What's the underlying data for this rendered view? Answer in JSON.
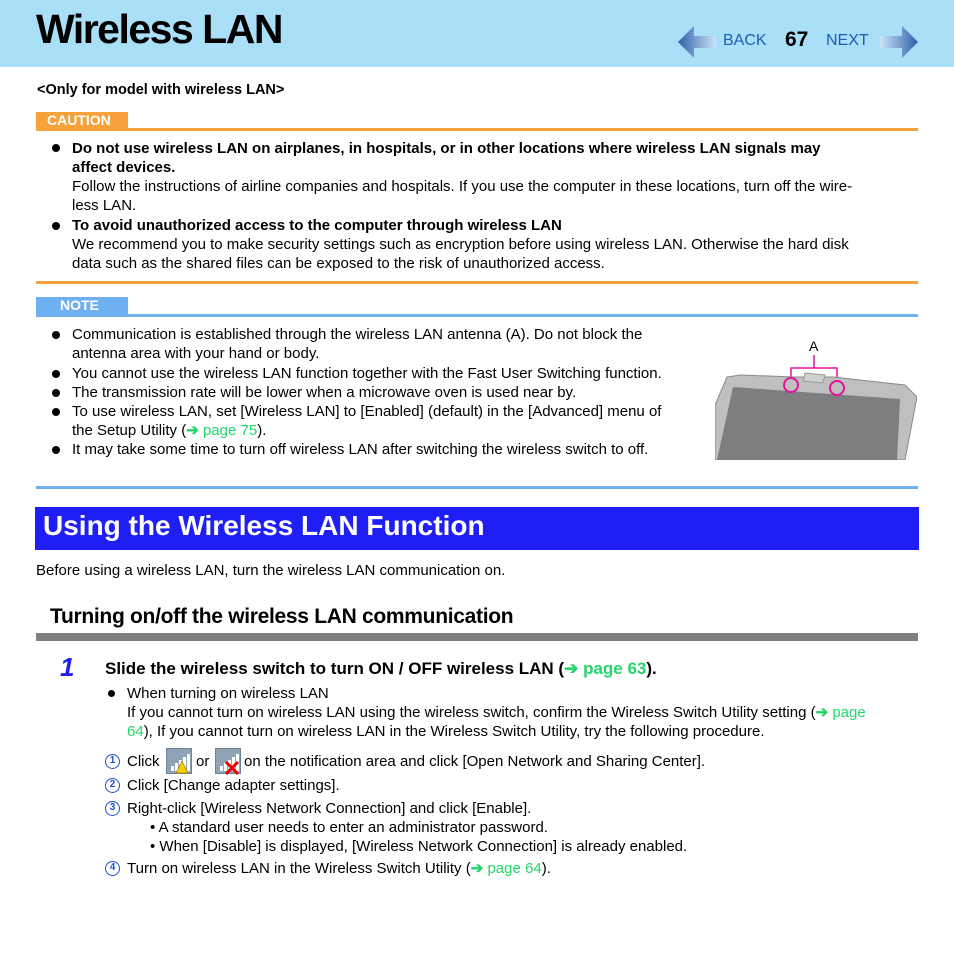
{
  "header": {
    "title": "Wireless LAN",
    "back_label": "BACK",
    "page_number": "67",
    "next_label": "NEXT",
    "background_color": "#a9dff7"
  },
  "model_note": "<Only for model with wireless LAN>",
  "caution": {
    "tag": "CAUTION",
    "color": "#f7a13b",
    "items": [
      {
        "heading_lines": [
          "Do not use wireless LAN on airplanes, in hospitals, or in other locations where wireless LAN signals may",
          "affect devices."
        ],
        "body_lines": [
          "Follow the instructions of airline companies and hospitals. If you use the computer in these locations, turn off the wire-",
          "less LAN."
        ]
      },
      {
        "heading_lines": [
          "To avoid unauthorized access to the computer through wireless LAN"
        ],
        "body_lines": [
          "We recommend you to make security settings such as encryption before using wireless LAN. Otherwise the hard disk",
          "data such as the shared files can be exposed to the risk of unauthorized access."
        ]
      }
    ]
  },
  "note": {
    "tag": "NOTE",
    "color": "#6fb0f1",
    "items": [
      {
        "lines": [
          "Communication is established through the wireless LAN antenna (A). Do not block the",
          "antenna area with your hand or body."
        ]
      },
      {
        "lines": [
          "You cannot use the wireless LAN function together with the Fast User Switching function."
        ]
      },
      {
        "lines": [
          "The transmission rate will be lower when a microwave oven is used near by."
        ]
      },
      {
        "lines": [
          "To use wireless LAN, set [Wireless LAN] to [Enabled] (default) in the [Advanced] menu of"
        ],
        "last_line_prefix": "the Setup Utility (",
        "link": "page 75",
        "last_line_suffix": ")."
      },
      {
        "lines": [
          "It may take some time to turn off wireless LAN after switching the wireless switch to off."
        ]
      }
    ],
    "illustration_label": "A"
  },
  "section": {
    "title": "Using the Wireless LAN Function",
    "intro": "Before using a wireless LAN, turn the wireless LAN communication on.",
    "subsection_title": "Turning on/off the wireless LAN communication"
  },
  "step": {
    "number": "1",
    "text_prefix": "Slide the wireless switch to turn ON / OFF wireless LAN (",
    "link": "page 63",
    "text_suffix": ").",
    "bullet": {
      "heading": "When turning on wireless LAN",
      "line1_prefix": "If you cannot turn on wireless LAN using the wireless switch, confirm the Wireless Switch Utility setting (",
      "line1_link": "page",
      "line2_link": "64",
      "line2_suffix": "), If you cannot turn on wireless LAN in the Wireless Switch Utility, try the following procedure."
    },
    "procedure": [
      {
        "num": "1",
        "prefix": "Click",
        "middle": "or",
        "suffix": "on the notification area and click [Open Network and Sharing Center]."
      },
      {
        "num": "2",
        "text": "Click [Change adapter settings]."
      },
      {
        "num": "3",
        "text": "Right-click [Wireless Network Connection] and click [Enable].",
        "subitems": [
          "A standard user needs to enter an administrator password.",
          "When [Disable] is displayed, [Wireless Network Connection] is already enabled."
        ]
      },
      {
        "num": "4",
        "prefix": "Turn on wireless LAN in the Wireless Switch Utility (",
        "link": "page 64",
        "suffix": ")."
      }
    ]
  },
  "icons": {
    "nav_back": "left-arrow",
    "nav_next": "right-arrow",
    "link_arrow": "➔",
    "network_warning": "network-warning-icon",
    "network_disconnected": "network-disconnected-icon"
  },
  "colors": {
    "link": "#22d66b",
    "section_bar": "#1f1ff5",
    "subsection_bar": "#808080"
  }
}
